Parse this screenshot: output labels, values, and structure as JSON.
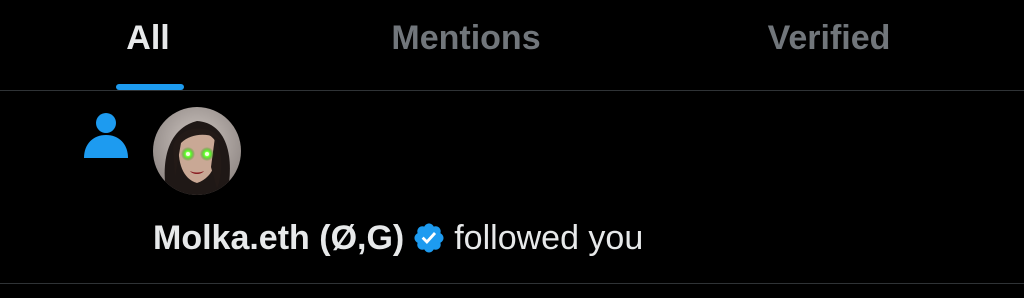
{
  "colors": {
    "background": "#000000",
    "accent": "#1d9bf0",
    "text_primary": "#e7e9ea",
    "text_secondary": "#71767b",
    "divider": "#2f3336"
  },
  "tabs": [
    {
      "label": "All",
      "active": true
    },
    {
      "label": "Mentions",
      "active": false
    },
    {
      "label": "Verified",
      "active": false
    }
  ],
  "notification": {
    "type_icon": "person-icon",
    "user_name": "Molka.eth (Ø,G)",
    "verified": true,
    "verified_icon": "verified-badge-icon",
    "action": "followed you"
  }
}
